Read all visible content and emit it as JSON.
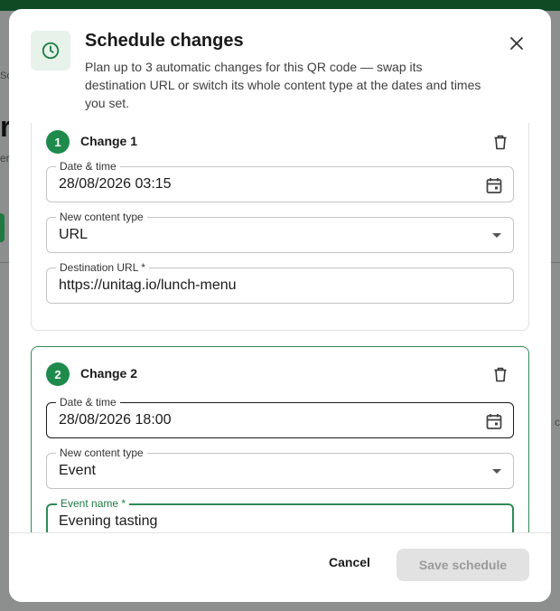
{
  "background": {
    "fragment_sc": "Sc",
    "fragment_r": "r",
    "fragment_er": "er",
    "fragment_rc": "c"
  },
  "modal": {
    "icon": "clock-icon",
    "title": "Schedule changes",
    "subtitle": "Plan up to 3 automatic changes for this QR code — swap its destination URL or switch its whole content type at the dates and times you set.",
    "close_icon": "close-icon"
  },
  "changes": [
    {
      "number": "1",
      "title": "Change 1",
      "date_label": "Date & time",
      "date_value": "28/08/2026 03:15",
      "type_label": "New content type",
      "type_value": "URL",
      "extra_label": "Destination URL *",
      "extra_value": "https://unitag.io/lunch-menu"
    },
    {
      "number": "2",
      "title": "Change 2",
      "date_label": "Date & time",
      "date_value": "28/08/2026 18:00",
      "type_label": "New content type",
      "type_value": "Event",
      "extra_label": "Event name *",
      "extra_value": "Evening tasting"
    }
  ],
  "footer": {
    "cancel_label": "Cancel",
    "save_label": "Save schedule"
  },
  "colors": {
    "accent": "#1e8a4c",
    "topbar": "#0f4a25",
    "disabled_bg": "#e2e2e2"
  }
}
